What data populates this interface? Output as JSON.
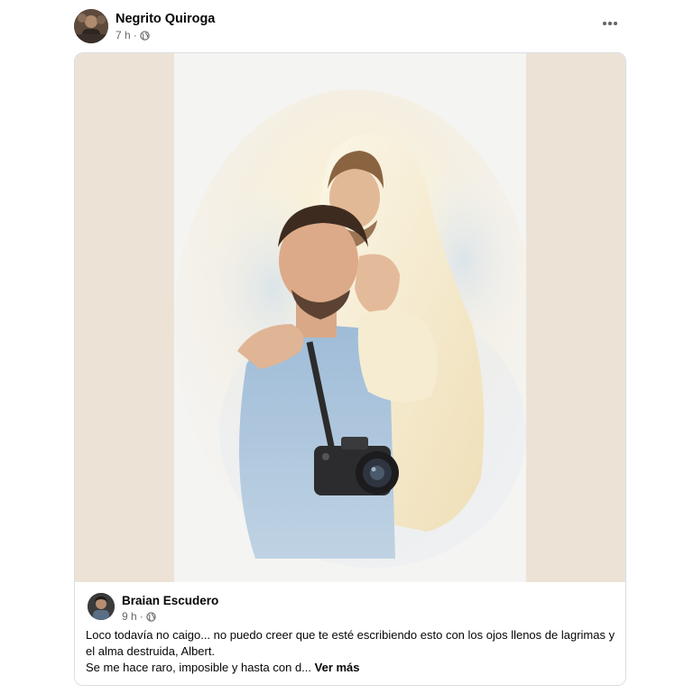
{
  "post": {
    "author": "Negrito Quiroga",
    "time": "7 h",
    "separator": "·",
    "privacy_icon": "globe-icon",
    "more_icon": "more-horizontal-icon"
  },
  "shared": {
    "author": "Braian Escudero",
    "time": "9 h",
    "separator": "·",
    "privacy_icon": "globe-icon",
    "text_line1": "Loco todavía no caigo... no puedo creer que te esté escribiendo esto con los ojos llenos de lagrimas y el alma destruida, Albert.",
    "text_line2": "Se me hace raro, imposible y hasta con d...",
    "see_more": "Ver más"
  },
  "colors": {
    "image_background": "#ece3d6",
    "secondary_text": "#65676b",
    "primary_text": "#050505"
  }
}
